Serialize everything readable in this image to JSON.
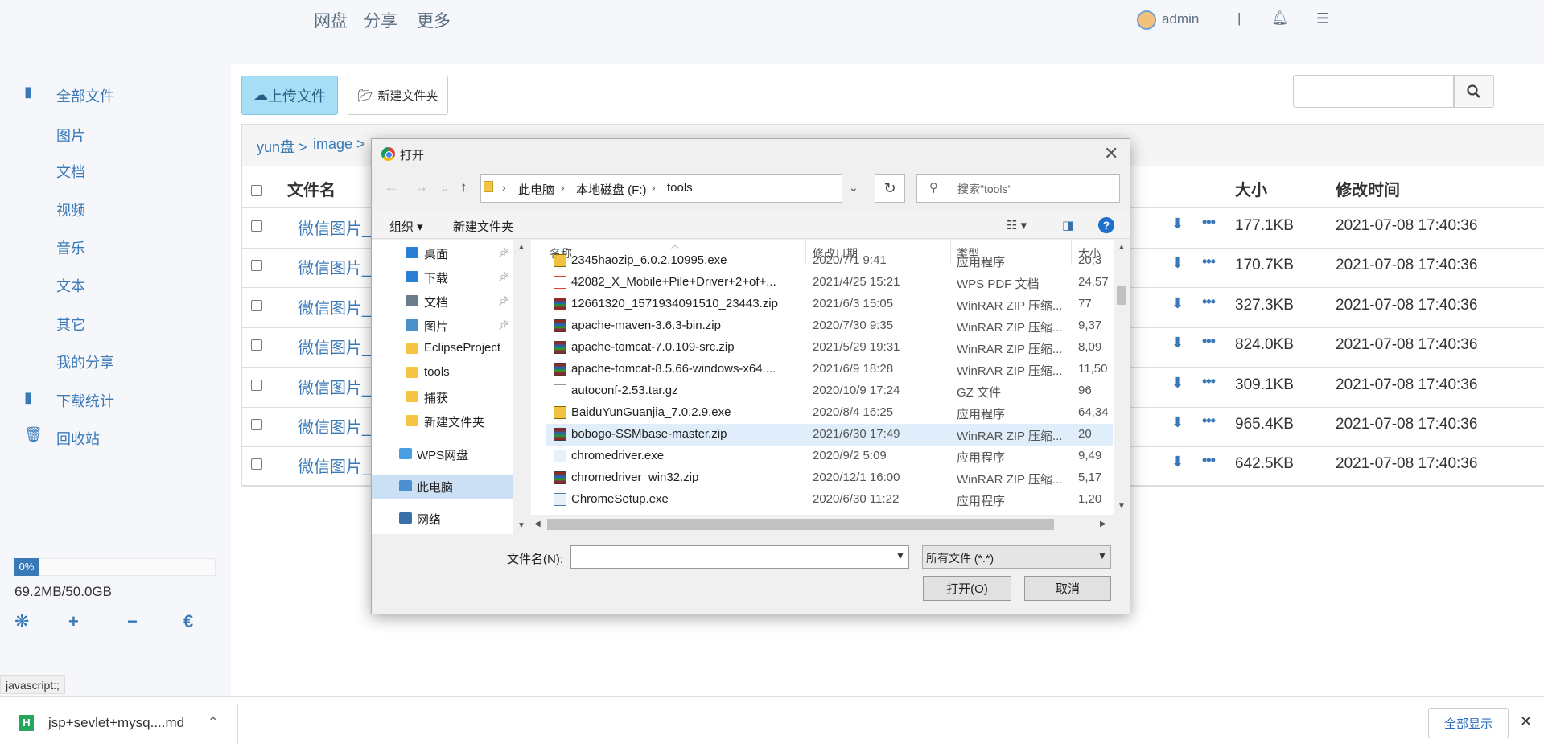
{
  "topnav": {
    "pan": "网盘",
    "share": "分享",
    "more": "更多"
  },
  "user": {
    "name": "admin",
    "separator": "|"
  },
  "sidebar": {
    "items": [
      "全部文件",
      "图片",
      "文档",
      "视频",
      "音乐",
      "文本",
      "其它",
      "我的分享",
      "下载统计",
      "回收站"
    ],
    "progress_label": "0%",
    "progress_fraction": 0,
    "usage": "69.2MB/50.0GB",
    "tools": [
      "❋",
      "+",
      "−",
      "€"
    ]
  },
  "status_url": "javascript:;",
  "toolbar": {
    "upload_label": "上传文件",
    "newfolder_label": "新建文件夹"
  },
  "breadcrumb": [
    "yun盘 >",
    "image >"
  ],
  "table": {
    "headers": {
      "name": "文件名",
      "size": "大小",
      "time": "修改时间"
    },
    "rows": [
      {
        "name": "微信图片_",
        "size": "177.1KB",
        "time": "2021-07-08 17:40:36"
      },
      {
        "name": "微信图片_",
        "size": "170.7KB",
        "time": "2021-07-08 17:40:36"
      },
      {
        "name": "微信图片_",
        "size": "327.3KB",
        "time": "2021-07-08 17:40:36"
      },
      {
        "name": "微信图片_",
        "size": "824.0KB",
        "time": "2021-07-08 17:40:36"
      },
      {
        "name": "微信图片_",
        "size": "309.1KB",
        "time": "2021-07-08 17:40:36"
      },
      {
        "name": "微信图片_",
        "size": "965.4KB",
        "time": "2021-07-08 17:40:36"
      },
      {
        "name": "微信图片_",
        "size": "642.5KB",
        "time": "2021-07-08 17:40:36"
      }
    ]
  },
  "download_bar": {
    "file": "jsp+sevlet+mysq....md",
    "show_all": "全部显示"
  },
  "dialog": {
    "title": "打开",
    "address": [
      "此电脑",
      "本地磁盘 (F:)",
      "tools"
    ],
    "search_placeholder": "搜索\"tools\"",
    "toolbar": {
      "organize": "组织 ▾",
      "new_folder": "新建文件夹"
    },
    "nav": [
      {
        "label": "桌面",
        "pinned": true
      },
      {
        "label": "下载",
        "pinned": true
      },
      {
        "label": "文档",
        "pinned": true
      },
      {
        "label": "图片",
        "pinned": true
      },
      {
        "label": "EclipseProject",
        "pinned": false
      },
      {
        "label": "tools",
        "pinned": false
      },
      {
        "label": "捕获",
        "pinned": false
      },
      {
        "label": "新建文件夹",
        "pinned": false
      },
      {
        "label": "WPS网盘",
        "pinned": false
      },
      {
        "label": "此电脑",
        "pinned": false
      },
      {
        "label": "网络",
        "pinned": false
      }
    ],
    "columns": {
      "name": "名称",
      "date": "修改日期",
      "type": "类型",
      "size": "大小"
    },
    "files": [
      {
        "name": "2345haozip_6.0.2.10995.exe",
        "date": "2020/7/1 9:41",
        "type": "应用程序",
        "size": "20,3",
        "kind": "inst"
      },
      {
        "name": "42082_X_Mobile+Pile+Driver+2+of+...",
        "date": "2021/4/25 15:21",
        "type": "WPS PDF 文档",
        "size": "24,57",
        "kind": "pdf"
      },
      {
        "name": "12661320_1571934091510_23443.zip",
        "date": "2021/6/3 15:05",
        "type": "WinRAR ZIP 压缩...",
        "size": "77",
        "kind": "zip"
      },
      {
        "name": "apache-maven-3.6.3-bin.zip",
        "date": "2020/7/30 9:35",
        "type": "WinRAR ZIP 压缩...",
        "size": "9,37",
        "kind": "zip"
      },
      {
        "name": "apache-tomcat-7.0.109-src.zip",
        "date": "2021/5/29 19:31",
        "type": "WinRAR ZIP 压缩...",
        "size": "8,09",
        "kind": "zip"
      },
      {
        "name": "apache-tomcat-8.5.66-windows-x64....",
        "date": "2021/6/9 18:28",
        "type": "WinRAR ZIP 压缩...",
        "size": "11,50",
        "kind": "zip"
      },
      {
        "name": "autoconf-2.53.tar.gz",
        "date": "2020/10/9 17:24",
        "type": "GZ 文件",
        "size": "96",
        "kind": "gz"
      },
      {
        "name": "BaiduYunGuanjia_7.0.2.9.exe",
        "date": "2020/8/4 16:25",
        "type": "应用程序",
        "size": "64,34",
        "kind": "inst"
      },
      {
        "name": "bobogo-SSMbase-master.zip",
        "date": "2021/6/30 17:49",
        "type": "WinRAR ZIP 压缩...",
        "size": "20",
        "kind": "zip"
      },
      {
        "name": "chromedriver.exe",
        "date": "2020/9/2 5:09",
        "type": "应用程序",
        "size": "9,49",
        "kind": "exe"
      },
      {
        "name": "chromedriver_win32.zip",
        "date": "2020/12/1 16:00",
        "type": "WinRAR ZIP 压缩...",
        "size": "5,17",
        "kind": "zip"
      },
      {
        "name": "ChromeSetup.exe",
        "date": "2020/6/30 11:22",
        "type": "应用程序",
        "size": "1,20",
        "kind": "exe"
      }
    ],
    "selected_file_index": 8,
    "filename_label": "文件名(N):",
    "filename_value": "",
    "filetype": "所有文件 (*.*)",
    "open_label": "打开(O)",
    "cancel_label": "取消"
  }
}
